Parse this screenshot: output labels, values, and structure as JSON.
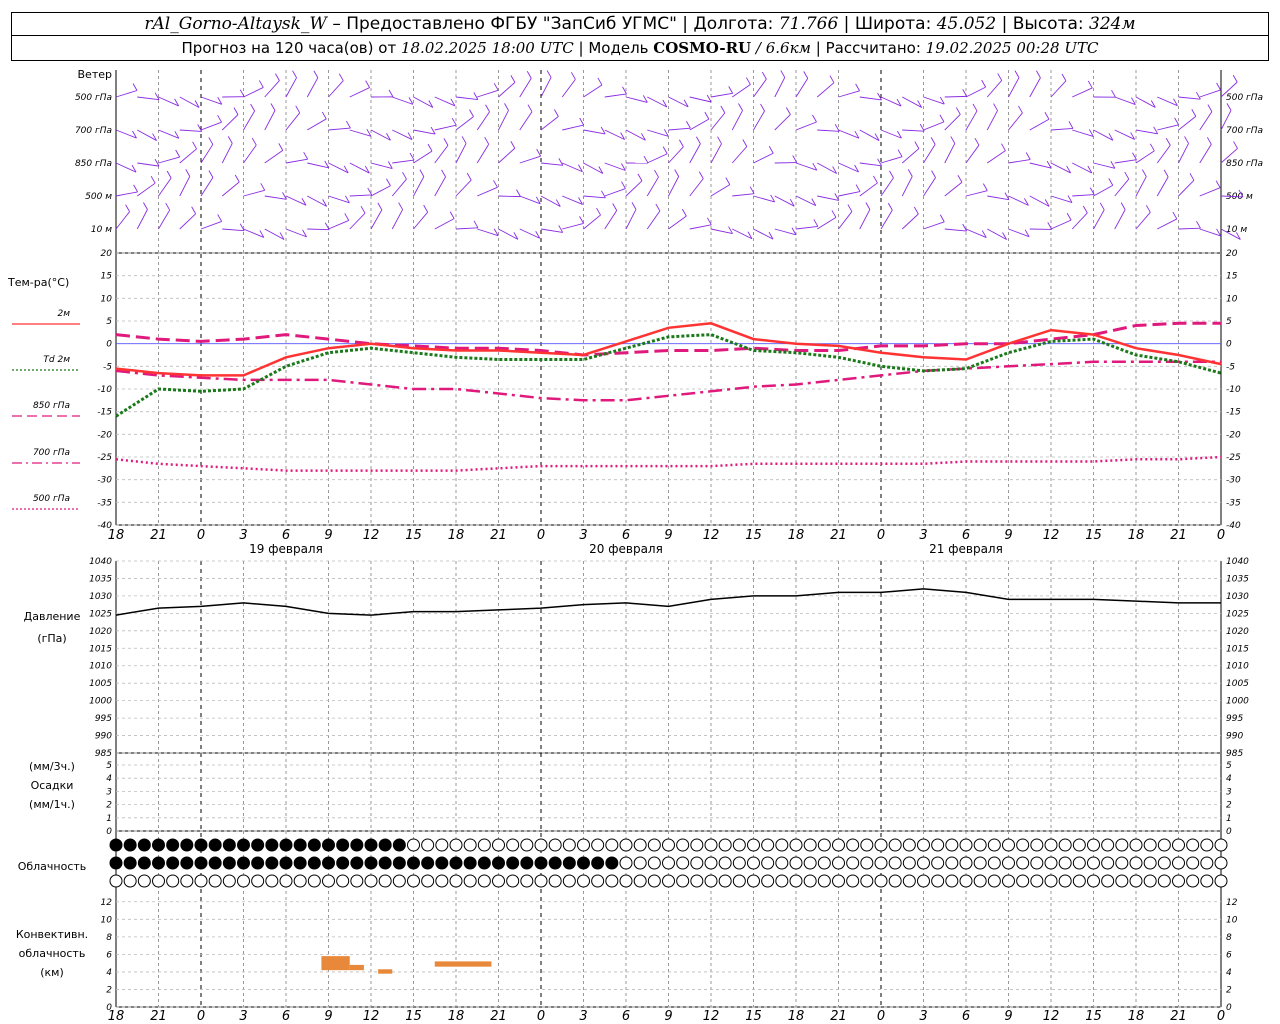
{
  "header": {
    "station": "rAl_Gorno-Altaysk_W",
    "dash": "–",
    "provider": "Предоставлено ФГБУ \"ЗапСиб УГМС\"",
    "lon_label": "Долгота:",
    "lon_value": "71.766",
    "lat_label": "Широта:",
    "lat_value": "45.052",
    "alt_label": "Высота:",
    "alt_value": "324м",
    "forecast_label": "Прогноз на 120 часа(ов) от",
    "forecast_start": "18.02.2025 18:00 UTC",
    "model_label": "Модель",
    "model_name": "COSMO-RU",
    "model_res": "/ 6.6км",
    "computed_label": "Рассчитано:",
    "computed_value": "19.02.2025 00:28 UTC"
  },
  "wind_panel": {
    "title": "Ветер",
    "levels": [
      "500 гПа",
      "700 гПа",
      "850 гПа",
      "500 м",
      "10  м"
    ],
    "color": "#8a2be2"
  },
  "temp_panel": {
    "title": "Тем-ра(°С)",
    "legend": [
      {
        "label": "2м",
        "color": "#ff3333",
        "style": "solid"
      },
      {
        "label": "Td  2м",
        "color": "#1a7a1a",
        "style": "dotted"
      },
      {
        "label": "850 гПа",
        "color": "#e0197d",
        "style": "dashed"
      },
      {
        "label": "700 гПа",
        "color": "#e0197d",
        "style": "dashdot"
      },
      {
        "label": "500 гПа",
        "color": "#e0197d",
        "style": "dotted"
      }
    ],
    "yticks": [
      "20",
      "15",
      "10",
      "5",
      "0",
      "-5",
      "-10",
      "-15",
      "-20",
      "-25",
      "-30",
      "-35",
      "-40"
    ]
  },
  "pressure_panel": {
    "title": "Давление",
    "unit": "(гПа)",
    "yticks": [
      "1040",
      "1035",
      "1030",
      "1025",
      "1020",
      "1015",
      "1010",
      "1005",
      "1000",
      "995",
      "990",
      "985"
    ]
  },
  "precip_panel": {
    "unit3": "(мм/3ч.)",
    "title": "Осадки",
    "unit1": "(мм/1ч.)",
    "yticks": [
      "5",
      "4",
      "3",
      "2",
      "1",
      "0"
    ]
  },
  "cloud_panel": {
    "title": "Облачность"
  },
  "conv_panel": {
    "title1": "Конвективн.",
    "title2": "облачность",
    "unit": "(км)",
    "yticks": [
      "12",
      "10",
      "8",
      "6",
      "4",
      "2",
      "0"
    ],
    "color": "#e8883a"
  },
  "x_axis": {
    "ticks": [
      "18",
      "21",
      "0",
      "3",
      "6",
      "9",
      "12",
      "15",
      "18",
      "21",
      "0",
      "3",
      "6",
      "9",
      "12",
      "15",
      "18",
      "21",
      "0",
      "3",
      "6",
      "9",
      "12",
      "15",
      "18",
      "21",
      "0"
    ],
    "dates": [
      "19 февраля",
      "20 февраля",
      "21 февраля"
    ]
  },
  "chart_data": {
    "type": "line",
    "x_hours": [
      0,
      3,
      6,
      9,
      12,
      15,
      18,
      21,
      24,
      27,
      30,
      33,
      36,
      39,
      42,
      45,
      48,
      51,
      54,
      57,
      60,
      63,
      66,
      69,
      72,
      75,
      78
    ],
    "t2m": [
      -5.5,
      -6.5,
      -7,
      -7,
      -3,
      -1,
      0,
      -1,
      -1.5,
      -1.5,
      -2,
      -2.5,
      0.5,
      3.5,
      4.5,
      1,
      0,
      -0.5,
      -2,
      -3,
      -3.5,
      0,
      3,
      2,
      -1,
      -2.5,
      -4.5
    ],
    "td2m": [
      -16,
      -10,
      -10.5,
      -10,
      -5,
      -2,
      -1,
      -2,
      -3,
      -3.5,
      -3.5,
      -3.5,
      -1,
      1.5,
      2,
      -1.5,
      -2,
      -3,
      -5,
      -6,
      -5.5,
      -2,
      0.5,
      1,
      -2.5,
      -4,
      -6.5
    ],
    "t850": [
      2,
      1,
      0.5,
      1,
      2,
      1,
      0,
      -0.5,
      -1,
      -1,
      -1.5,
      -2.5,
      -2,
      -1.5,
      -1.5,
      -1,
      -1.5,
      -1.5,
      -0.5,
      -0.5,
      0,
      0,
      1,
      2,
      4,
      4.5,
      4.5
    ],
    "t700": [
      -6,
      -7,
      -7.5,
      -8,
      -8,
      -8,
      -9,
      -10,
      -10,
      -11,
      -12,
      -12.5,
      -12.5,
      -11.5,
      -10.5,
      -9.5,
      -9,
      -8,
      -7,
      -6,
      -5.5,
      -5,
      -4.5,
      -4,
      -4,
      -4,
      -4
    ],
    "t500": [
      -25.5,
      -26.5,
      -27,
      -27.5,
      -28,
      -28,
      -28,
      -28,
      -28,
      -27.5,
      -27,
      -27,
      -27,
      -27,
      -27,
      -26.5,
      -26.5,
      -26.5,
      -26.5,
      -26.5,
      -26,
      -26,
      -26,
      -26,
      -25.5,
      -25.5,
      -25
    ],
    "pressure": [
      1024.5,
      1026.5,
      1027,
      1028,
      1027,
      1025,
      1024.5,
      1025.5,
      1025.5,
      1026,
      1026.5,
      1027.5,
      1028,
      1027,
      1029,
      1030,
      1030,
      1031,
      1031,
      1032,
      1031,
      1029,
      1029,
      1029,
      1028.5,
      1028,
      1028
    ],
    "precip": [
      0,
      0,
      0,
      0,
      0,
      0,
      0,
      0,
      0,
      0,
      0,
      0,
      0,
      0,
      0,
      0,
      0,
      0,
      0,
      0,
      0,
      0,
      0,
      0,
      0,
      0,
      0
    ],
    "convective_cloud_km": [
      {
        "hour_start": 14.5,
        "hour_end": 16.5,
        "base": 4.2,
        "top": 5.8
      },
      {
        "hour_start": 16.5,
        "hour_end": 17.5,
        "base": 4.2,
        "top": 4.8
      },
      {
        "hour_start": 18.5,
        "hour_end": 19.5,
        "base": 3.8,
        "top": 4.3
      },
      {
        "hour_start": 22.5,
        "hour_end": 26.5,
        "base": 4.6,
        "top": 5.2
      }
    ],
    "xlim": [
      0,
      78
    ],
    "temp_ylim": [
      -40,
      20
    ],
    "pressure_ylim": [
      985,
      1040
    ],
    "precip_ylim": [
      0,
      5
    ],
    "conv_ylim": [
      0,
      13
    ],
    "grid": true
  }
}
